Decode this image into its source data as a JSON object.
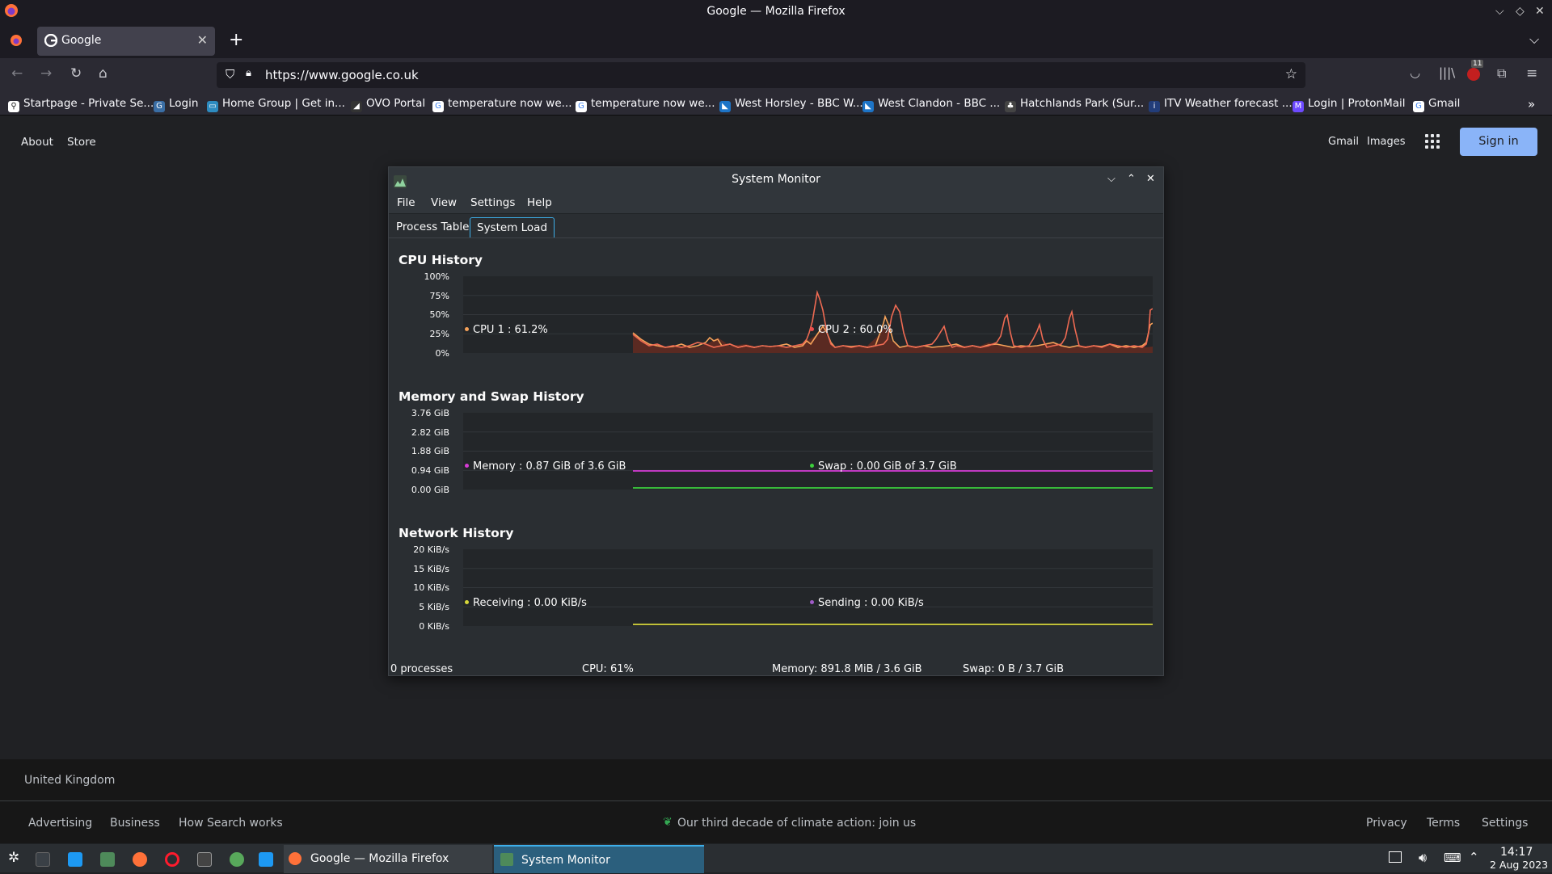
{
  "window_title": "Google — Mozilla Firefox",
  "tab": {
    "title": "Google"
  },
  "url": "https://www.google.co.uk",
  "extension_badge": "11",
  "bookmarks": [
    "Startpage - Private Se...",
    "Login",
    "Home Group | Get in...",
    "OVO Portal",
    "temperature now we...",
    "temperature now we...",
    "West Horsley - BBC W...",
    "West Clandon - BBC ...",
    "Hatchlands Park (Sur...",
    "ITV Weather forecast ...",
    "Login | ProtonMail",
    "Gmail"
  ],
  "google": {
    "about": "About",
    "store": "Store",
    "gmail": "Gmail",
    "images": "Images",
    "sign_in": "Sign in"
  },
  "footer": {
    "country": "United Kingdom",
    "advertising": "Advertising",
    "business": "Business",
    "how_search": "How Search works",
    "climate": "Our third decade of climate action: join us",
    "privacy": "Privacy",
    "terms": "Terms",
    "settings": "Settings"
  },
  "sysmon": {
    "title": "System Monitor",
    "menu": [
      "File",
      "View",
      "Settings",
      "Help"
    ],
    "tabs": [
      "Process Table",
      "System Load"
    ],
    "cpu": {
      "title": "CPU History",
      "ticks": [
        "100%",
        "75%",
        "50%",
        "25%",
        "0%"
      ],
      "legend1": "CPU 1 : 61.2%",
      "legend2": "CPU 2 : 60.0%"
    },
    "mem": {
      "title": "Memory and Swap History",
      "ticks": [
        "3.76 GiB",
        "2.82 GiB",
        "1.88 GiB",
        "0.94 GiB",
        "0.00 GiB"
      ],
      "legend1": "Memory : 0.87 GiB of 3.6 GiB",
      "legend2": "Swap : 0.00 GiB of 3.7 GiB"
    },
    "net": {
      "title": "Network History",
      "ticks": [
        "20 KiB/s",
        "15 KiB/s",
        "10 KiB/s",
        "5 KiB/s",
        "0 KiB/s"
      ],
      "legend1": "Receiving : 0.00 KiB/s",
      "legend2": "Sending : 0.00 KiB/s"
    },
    "status": {
      "processes": "0 processes",
      "cpu": "CPU: 61%",
      "memory": "Memory: 891.8 MiB / 3.6 GiB",
      "swap": "Swap: 0 B / 3.7 GiB"
    },
    "colors": {
      "cpu1": "#f6a25a",
      "cpu2": "#ee4c4c",
      "memory": "#d63bd6",
      "swap": "#3ccf3c",
      "receiving": "#d7d73a",
      "sending": "#a05cc8"
    }
  },
  "taskbar": {
    "task1": "Google — Mozilla Firefox",
    "task2": "System Monitor",
    "time": "14:17",
    "date": "2 Aug 2023"
  }
}
